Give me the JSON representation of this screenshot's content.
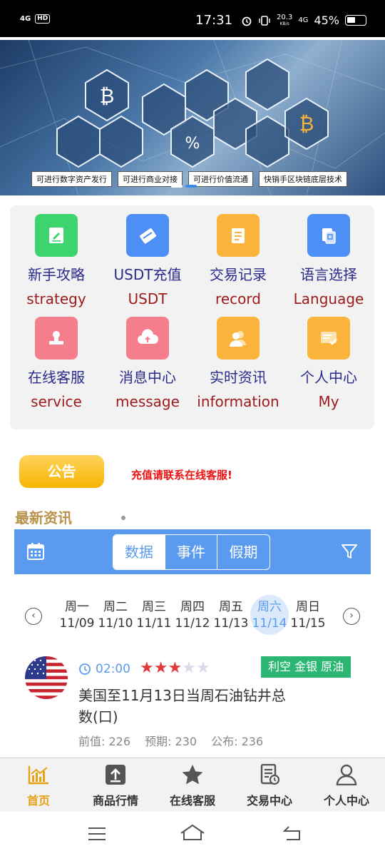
{
  "status": {
    "time": "17:31",
    "net_speed": "20.3",
    "net_unit": "KB/s",
    "net_type": "4G",
    "battery": "45%",
    "signal": "4G",
    "hd": "HD"
  },
  "banner": {
    "tags": [
      "可进行数字资产发行",
      "可进行商业对接",
      "可进行价值流通",
      "快销手区块链底层技术"
    ]
  },
  "menu": {
    "items": [
      {
        "cn": "新手攻略",
        "en": "strategy",
        "icon": "edit-doc-icon",
        "color": "#3dd36f"
      },
      {
        "cn": "USDT充值",
        "en": "USDT",
        "icon": "card-icon",
        "color": "#4e8ff5"
      },
      {
        "cn": "交易记录",
        "en": "record",
        "icon": "receipt-icon",
        "color": "#fbb43b"
      },
      {
        "cn": "语言选择",
        "en": "Language",
        "icon": "translate-icon",
        "color": "#4e8ff5"
      },
      {
        "cn": "在线客服",
        "en": "service",
        "icon": "stamp-icon",
        "color": "#f57e8d"
      },
      {
        "cn": "消息中心",
        "en": "message",
        "icon": "cloud-upload-icon",
        "color": "#f57e8d"
      },
      {
        "cn": "实时资讯",
        "en": "information",
        "icon": "users-icon",
        "color": "#fbb43b"
      },
      {
        "cn": "个人中心",
        "en": "My",
        "icon": "profile-card-icon",
        "color": "#fbb43b"
      }
    ]
  },
  "notice": {
    "label": "公告",
    "text": "充值请联系在线客服!"
  },
  "news": {
    "title": "最新资讯"
  },
  "calendar": {
    "tabs": [
      "数据",
      "事件",
      "假期"
    ],
    "active_tab": 0,
    "days": [
      {
        "name": "周一",
        "date": "11/09"
      },
      {
        "name": "周二",
        "date": "11/10"
      },
      {
        "name": "周三",
        "date": "11/11"
      },
      {
        "name": "周四",
        "date": "11/12"
      },
      {
        "name": "周五",
        "date": "11/13"
      },
      {
        "name": "周六",
        "date": "11/14"
      },
      {
        "name": "周日",
        "date": "11/15"
      }
    ],
    "active_day": 5
  },
  "event": {
    "time": "02:00",
    "stars": 3,
    "stars_max": 5,
    "tag": "利空 金银 原油",
    "title": "美国至11月13日当周石油钻井总数(口)",
    "previous_label": "前值:",
    "previous": "226",
    "forecast_label": "预期:",
    "forecast": "230",
    "actual_label": "公布:",
    "actual": "236"
  },
  "tabbar": {
    "items": [
      {
        "label": "首页",
        "icon": "chart-home-icon"
      },
      {
        "label": "商品行情",
        "icon": "upload-box-icon"
      },
      {
        "label": "在线客服",
        "icon": "star-icon"
      },
      {
        "label": "交易中心",
        "icon": "document-clock-icon"
      },
      {
        "label": "个人中心",
        "icon": "person-icon"
      }
    ],
    "active": 0
  }
}
